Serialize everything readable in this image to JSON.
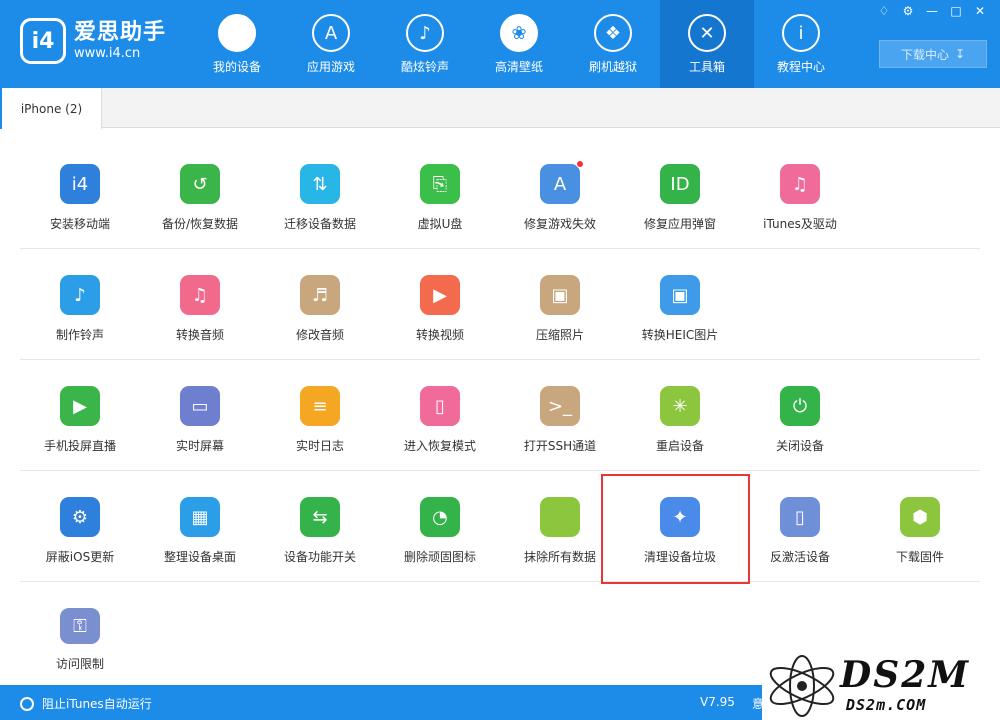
{
  "app": {
    "name": "爱思助手",
    "url": "www.i4.cn",
    "badge": "i4",
    "brand_color": "#1d8ce8"
  },
  "nav": [
    {
      "label": "我的设备",
      "icon": "apple-icon",
      "glyph": ""
    },
    {
      "label": "应用游戏",
      "icon": "app-store-icon",
      "glyph": "A"
    },
    {
      "label": "酷炫铃声",
      "icon": "bell-icon",
      "glyph": "♪"
    },
    {
      "label": "高清壁纸",
      "icon": "flower-icon",
      "glyph": "❀"
    },
    {
      "label": "刷机越狱",
      "icon": "dropbox-icon",
      "glyph": "❖"
    },
    {
      "label": "工具箱",
      "icon": "tools-icon",
      "glyph": "✕",
      "active": true
    },
    {
      "label": "教程中心",
      "icon": "info-icon",
      "glyph": "i"
    }
  ],
  "window_controls": [
    "shirt-icon",
    "gear-icon",
    "minimize-icon",
    "maximize-icon",
    "close-icon"
  ],
  "download_center": {
    "label": "下载中心",
    "icon": "download-icon"
  },
  "tab": {
    "label": "iPhone (2)"
  },
  "tools": [
    [
      {
        "label": "安装移动端",
        "icon": "i4-app-icon",
        "color": "#2f7fdc",
        "glyph": "i4"
      },
      {
        "label": "备份/恢复数据",
        "icon": "backup-restore-icon",
        "color": "#3bb54a",
        "glyph": "↺"
      },
      {
        "label": "迁移设备数据",
        "icon": "migrate-data-icon",
        "color": "#28b6e6",
        "glyph": "⇅"
      },
      {
        "label": "虚拟U盘",
        "icon": "usb-drive-icon",
        "color": "#3cbf4a",
        "glyph": "⎘"
      },
      {
        "label": "修复游戏失效",
        "icon": "fix-game-icon",
        "color": "#4a90e2",
        "glyph": "A",
        "dot": true
      },
      {
        "label": "修复应用弹窗",
        "icon": "apple-id-icon",
        "color": "#34b34a",
        "glyph": "ID"
      },
      {
        "label": "iTunes及驱动",
        "icon": "itunes-icon",
        "color": "#f06a9a",
        "glyph": "♫"
      }
    ],
    [
      {
        "label": "制作铃声",
        "icon": "ringtone-bell-icon",
        "color": "#2c9ee8",
        "glyph": "♪"
      },
      {
        "label": "转换音频",
        "icon": "convert-audio-icon",
        "color": "#f16a8c",
        "glyph": "♫"
      },
      {
        "label": "修改音频",
        "icon": "edit-audio-icon",
        "color": "#c8a77f",
        "glyph": "♬"
      },
      {
        "label": "转换视频",
        "icon": "convert-video-icon",
        "color": "#f36a4e",
        "glyph": "▶"
      },
      {
        "label": "压缩照片",
        "icon": "compress-photo-icon",
        "color": "#c8a77f",
        "glyph": "▣"
      },
      {
        "label": "转换HEIC图片",
        "icon": "heic-image-icon",
        "color": "#3d9be9",
        "glyph": "▣"
      }
    ],
    [
      {
        "label": "手机投屏直播",
        "icon": "screen-cast-icon",
        "color": "#3bb54a",
        "glyph": "▶"
      },
      {
        "label": "实时屏幕",
        "icon": "realtime-screen-icon",
        "color": "#6f7fd0",
        "glyph": "▭"
      },
      {
        "label": "实时日志",
        "icon": "realtime-log-icon",
        "color": "#f5a623",
        "glyph": "≡"
      },
      {
        "label": "进入恢复模式",
        "icon": "recovery-mode-icon",
        "color": "#f06a9a",
        "glyph": "▯"
      },
      {
        "label": "打开SSH通道",
        "icon": "ssh-terminal-icon",
        "color": "#c8a77f",
        "glyph": ">_"
      },
      {
        "label": "重启设备",
        "icon": "restart-icon",
        "color": "#8cc63f",
        "glyph": "✳"
      },
      {
        "label": "关闭设备",
        "icon": "power-icon",
        "color": "#34b34a",
        "glyph": "⏻"
      }
    ],
    [
      {
        "label": "屏蔽iOS更新",
        "icon": "block-update-icon",
        "color": "#2f7fdc",
        "glyph": "⚙"
      },
      {
        "label": "整理设备桌面",
        "icon": "organize-desktop-icon",
        "color": "#2c9ee8",
        "glyph": "▦"
      },
      {
        "label": "设备功能开关",
        "icon": "feature-toggle-icon",
        "color": "#34b34a",
        "glyph": "⇆"
      },
      {
        "label": "删除顽固图标",
        "icon": "delete-icon-icon",
        "color": "#34b34a",
        "glyph": "◔"
      },
      {
        "label": "抹除所有数据",
        "icon": "erase-data-icon",
        "color": "#8cc63f",
        "glyph": ""
      },
      {
        "label": "清理设备垃圾",
        "icon": "clean-junk-icon",
        "color": "#4a8ae8",
        "glyph": "✦",
        "highlighted": true
      },
      {
        "label": "反激活设备",
        "icon": "deactivate-icon",
        "color": "#6f8fd8",
        "glyph": "▯"
      },
      {
        "label": "下载固件",
        "icon": "download-firmware-icon",
        "color": "#8cc63f",
        "glyph": "⬢"
      }
    ],
    [
      {
        "label": "访问限制",
        "icon": "access-restriction-icon",
        "color": "#7a8fd0",
        "glyph": "⚿"
      }
    ]
  ],
  "status": {
    "itunes_toggle": "阻止iTunes自动运行",
    "version": "V7.95",
    "feedback_partial": "意"
  },
  "watermark": {
    "text": "DS2M",
    "sub": "DS2m.COM"
  }
}
